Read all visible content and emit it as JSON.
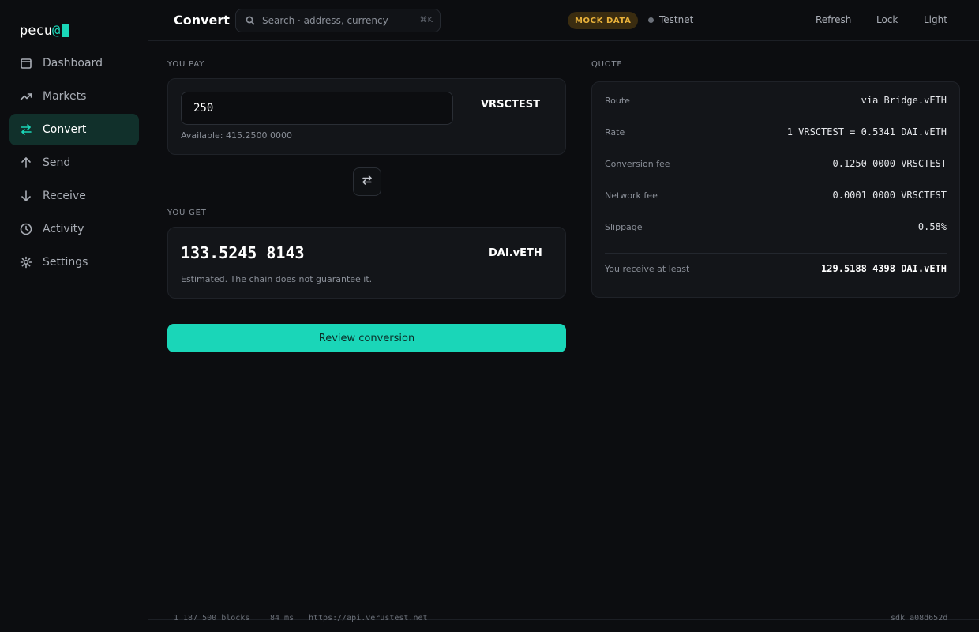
{
  "app": {
    "logo_text": "pecu",
    "logo_at": "@"
  },
  "sidebar": {
    "items": [
      {
        "label": "Dashboard",
        "icon": "wallet-icon"
      },
      {
        "label": "Markets",
        "icon": "trend-up-icon"
      },
      {
        "label": "Convert",
        "icon": "swap-arrows-icon",
        "active": true
      },
      {
        "label": "Send",
        "icon": "arrow-up-icon"
      },
      {
        "label": "Receive",
        "icon": "arrow-down-icon"
      },
      {
        "label": "Activity",
        "icon": "clock-icon"
      },
      {
        "label": "Settings",
        "icon": "gear-icon"
      }
    ]
  },
  "header": {
    "title": "Convert",
    "search_placeholder": "Search · address, currency",
    "search_shortcut": "⌘K",
    "mock_badge": "MOCK DATA",
    "network": "Testnet",
    "refresh": "Refresh",
    "lock": "Lock",
    "theme": "Light"
  },
  "convert": {
    "pay_label": "YOU PAY",
    "pay_amount": "250",
    "pay_currency": "VRSCTEST",
    "available": "Available: 415.2500 0000",
    "get_label": "YOU GET",
    "get_amount": "133.5245 8143",
    "get_currency": "DAI.vETH",
    "estimate_note": "Estimated. The chain does not guarantee it.",
    "review_button": "Review conversion"
  },
  "quote": {
    "label": "QUOTE",
    "rows": [
      {
        "key": "Route",
        "value": "via Bridge.vETH"
      },
      {
        "key": "Rate",
        "value": "1 VRSCTEST = 0.5341 DAI.vETH"
      },
      {
        "key": "Conversion fee",
        "value": "0.1250 0000 VRSCTEST"
      },
      {
        "key": "Network fee",
        "value": "0.0001 0000 VRSCTEST"
      },
      {
        "key": "Slippage",
        "value": "0.58%"
      }
    ],
    "min_receive_key": "You receive at least",
    "min_receive_value": "129.5188 4398 DAI.vETH"
  },
  "footer": {
    "blocks": "1 187 500 blocks",
    "latency": "84 ms",
    "endpoint": "https://api.verustest.net",
    "sdk": "sdk a08d652d"
  },
  "colors": {
    "accent": "#1ad6b8",
    "background": "#0c0d10",
    "badge": "#e8b13a"
  }
}
